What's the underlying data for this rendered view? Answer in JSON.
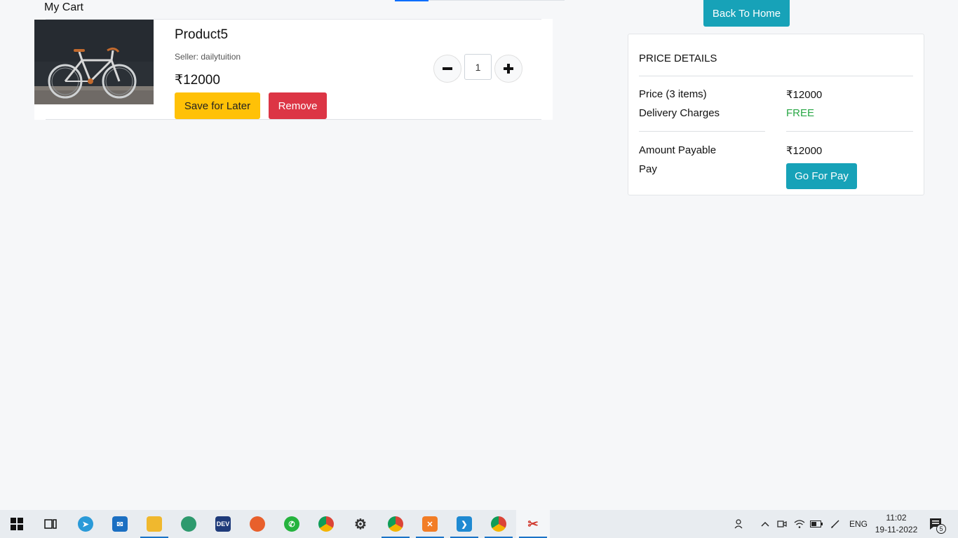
{
  "cart": {
    "title": "My Cart",
    "item": {
      "name": "Product5",
      "seller": "Seller: dailytuition",
      "price": "₹12000",
      "quantity": "1",
      "image": "bicycle-image",
      "save_label": "Save for Later",
      "remove_label": "Remove",
      "minus_icon": "minus-icon",
      "plus_icon": "plus-icon"
    }
  },
  "header": {
    "back_home_label": "Back To Home"
  },
  "price_details": {
    "title": "PRICE DETAILS",
    "price_label": "Price (3 items)",
    "price_value": "₹12000",
    "delivery_label": "Delivery Charges",
    "delivery_value": "FREE",
    "amount_label": "Amount Payable",
    "amount_value": "₹12000",
    "pay_label": "Pay",
    "pay_button": "Go For Pay"
  },
  "colors": {
    "save": "#ffc107",
    "remove": "#dc3545",
    "accent": "#17a2b8",
    "free": "#28a745"
  },
  "taskbar": {
    "icons": [
      "windows-start-icon",
      "task-view-icon",
      "telegram-icon",
      "mail-icon",
      "file-explorer-icon",
      "edge-icon",
      "dev-icon",
      "firefox-icon",
      "whatsapp-icon",
      "chrome-icon",
      "settings-icon",
      "chrome-profile-icon",
      "xampp-icon",
      "vscode-icon",
      "chrome-profile-2-icon",
      "snipping-tool-icon"
    ],
    "language": "ENG",
    "time": "11:02",
    "date": "19-11-2022",
    "notification_count": "5"
  }
}
